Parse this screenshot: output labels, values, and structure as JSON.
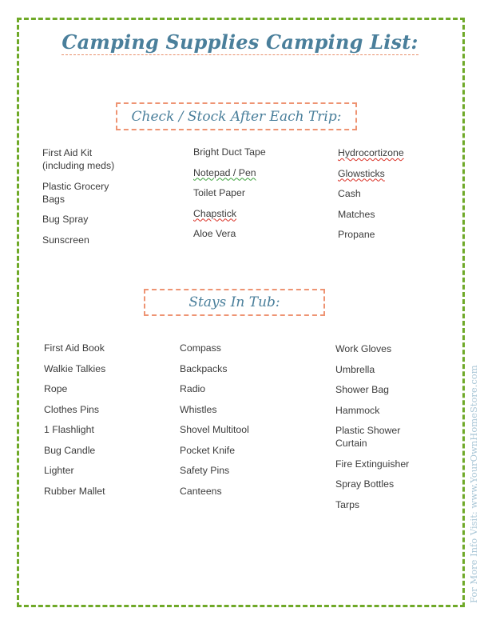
{
  "title": "Camping Supplies Camping List:",
  "sections": {
    "check_stock": {
      "heading": "Check / Stock After Each Trip:",
      "columns": [
        [
          "First Aid Kit (including meds)",
          "Plastic Grocery Bags",
          "Bug Spray",
          "Sunscreen"
        ],
        [
          "Bright Duct Tape",
          "Notepad / Pen",
          "Toilet Paper",
          "Chapstick",
          "Aloe Vera"
        ],
        [
          "Hydrocortizone",
          "Glowsticks",
          "Cash",
          "Matches",
          "Propane"
        ]
      ]
    },
    "stays_in_tub": {
      "heading": "Stays In Tub:",
      "columns": [
        [
          "First Aid Book",
          "Walkie Talkies",
          "Rope",
          "Clothes Pins",
          "1 Flashlight",
          "Bug Candle",
          "Lighter",
          "Rubber Mallet"
        ],
        [
          "Compass",
          "Backpacks",
          "Radio",
          "Whistles",
          "Shovel Multitool",
          "Pocket Knife",
          "Safety Pins",
          "Canteens"
        ],
        [
          "Work Gloves",
          "Umbrella",
          "Shower Bag",
          "Hammock",
          "Plastic Shower Curtain",
          "Fire Extinguisher",
          "Spray Bottles",
          "Tarps"
        ]
      ]
    }
  },
  "side_note": "For More Info Visit: www.YourOwnHomeStore.com",
  "colors": {
    "border": "#6fa928",
    "heading": "#4a7f9b",
    "box_border": "#ee9473",
    "side_text": "#a9c6d6"
  }
}
